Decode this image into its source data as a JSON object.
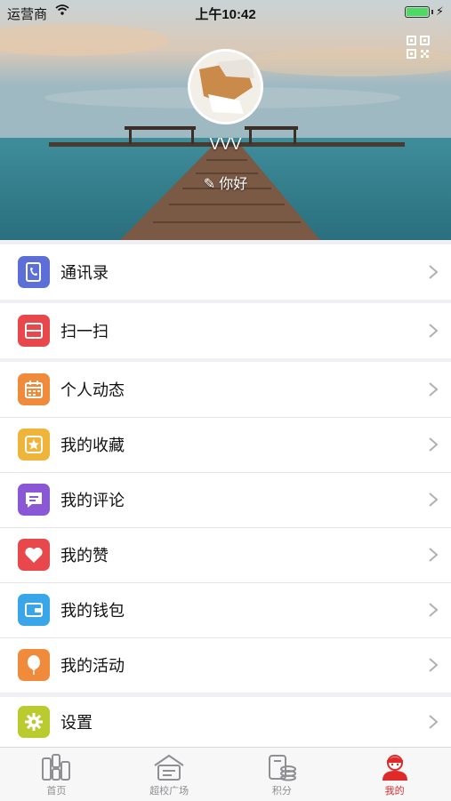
{
  "status_bar": {
    "carrier": "运营商",
    "time": "上午10:42"
  },
  "profile": {
    "username": "VVV",
    "bio": "你好"
  },
  "menu_groups": [
    [
      {
        "label": "通讯录",
        "icon": "contacts-icon",
        "color": "#5c6fd9"
      }
    ],
    [
      {
        "label": "扫一扫",
        "icon": "scan-icon",
        "color": "#e8474c"
      }
    ],
    [
      {
        "label": "个人动态",
        "icon": "calendar-icon",
        "color": "#f08b3c"
      },
      {
        "label": "我的收藏",
        "icon": "star-icon",
        "color": "#efb53a"
      },
      {
        "label": "我的评论",
        "icon": "comment-icon",
        "color": "#8a58d6"
      },
      {
        "label": "我的赞",
        "icon": "heart-icon",
        "color": "#e8474c"
      },
      {
        "label": "我的钱包",
        "icon": "wallet-icon",
        "color": "#3aa6ea"
      },
      {
        "label": "我的活动",
        "icon": "balloon-icon",
        "color": "#f08b3c"
      }
    ],
    [
      {
        "label": "设置",
        "icon": "gear-icon",
        "color": "#b9cb2f"
      }
    ]
  ],
  "tabs": [
    {
      "label": "首页",
      "icon": "home-icon",
      "active": false
    },
    {
      "label": "超校广场",
      "icon": "plaza-icon",
      "active": false
    },
    {
      "label": "积分",
      "icon": "points-icon",
      "active": false
    },
    {
      "label": "我的",
      "icon": "profile-icon",
      "active": true
    }
  ],
  "colors": {
    "active_tab": "#e02a2a",
    "background": "#efeff4"
  }
}
